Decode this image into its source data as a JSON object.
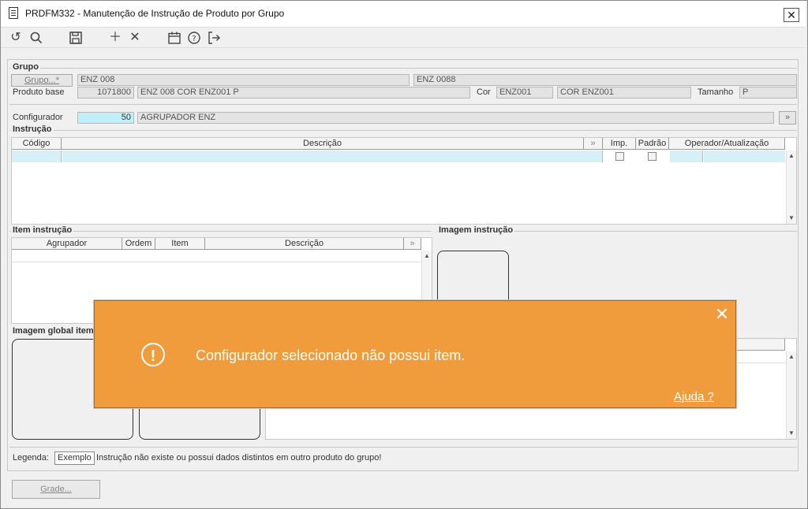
{
  "window": {
    "title": "PRDFM332 - Manutenção de Instrução de Produto por Grupo"
  },
  "icons": {
    "doc": "document-icon",
    "close": "close-icon",
    "refresh": "refresh-icon",
    "search": "search-icon",
    "save": "save-icon",
    "add": "plus-icon",
    "remove": "x-icon",
    "calendar": "calendar-icon",
    "help": "help-icon",
    "exit": "exit-icon",
    "expand": "double-chevron-icon",
    "alert": "alert-circle-icon"
  },
  "grupo": {
    "legend": "Grupo",
    "grupo_button": "Grupo...*",
    "grupo_value": "ENZ 008",
    "grupo_value2": "ENZ 0088",
    "produto_label": "Produto base",
    "produto_code": "1071800",
    "produto_desc": "ENZ 008 COR ENZ001 P",
    "cor_label": "Cor",
    "cor_code": "ENZ001",
    "cor_desc": "COR ENZ001",
    "tamanho_label": "Tamanho",
    "tamanho_value": "P"
  },
  "configurador": {
    "label": "Configurador",
    "value": "50",
    "desc": "AGRUPADOR ENZ"
  },
  "instrucao": {
    "legend": "Instrução",
    "columns": [
      "Código",
      "Descrição",
      "Imp.",
      "Padrão",
      "Operador/Atualização"
    ]
  },
  "item_instrucao": {
    "legend": "Item instrução",
    "columns": [
      "Agrupador",
      "Ordem",
      "Item",
      "Descrição"
    ]
  },
  "imagem_instrucao": {
    "legend": "Imagem instrução"
  },
  "imagem_global": {
    "legend": "Imagem global item"
  },
  "legenda": {
    "label": "Legenda:",
    "sample": "Exemplo",
    "text": "Instrução não existe ou possui dados distintos em outro produto do grupo!"
  },
  "bottom": {
    "grade_button": "Grade..."
  },
  "toast": {
    "message": "Configurador selecionado não possui item.",
    "help_link": "Ajuda ?",
    "color": "#f09c3c"
  }
}
